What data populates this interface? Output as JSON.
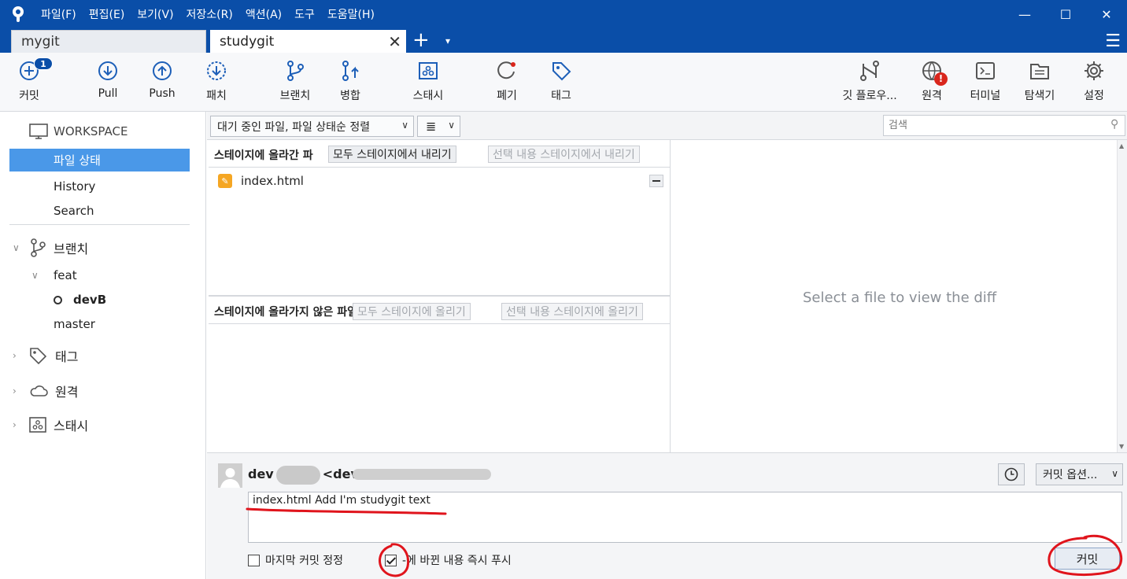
{
  "window": {
    "menu": [
      "파일(F)",
      "편집(E)",
      "보기(V)",
      "저장소(R)",
      "액션(A)",
      "도구",
      "도움말(H)"
    ],
    "controls": {
      "minimize": "—",
      "maximize": "☐",
      "close": "✕"
    }
  },
  "tabs": [
    {
      "label": "mygit",
      "active": false
    },
    {
      "label": "studygit",
      "active": true
    }
  ],
  "tab_actions": {
    "close": "✕",
    "add": "+",
    "dropdown": "▾",
    "menu": "☰"
  },
  "toolbar": {
    "commit": {
      "label": "커밋",
      "badge": "1"
    },
    "pull": "Pull",
    "push": "Push",
    "patch": "패치",
    "branch": "브랜치",
    "merge": "병합",
    "stash": "스태시",
    "discard": "폐기",
    "tag": "태그",
    "gitflow": "깃 플로우...",
    "remote": {
      "label": "원격",
      "alert": "!"
    },
    "terminal": "터미널",
    "explorer": "탐색기",
    "settings": "설정"
  },
  "sidebar": {
    "workspace": "WORKSPACE",
    "workspace_items": [
      "파일 상태",
      "History",
      "Search"
    ],
    "selected": "파일 상태",
    "branches_label": "브랜치",
    "branch_folder": "feat",
    "branches": [
      {
        "name": "devB",
        "current": true
      },
      {
        "name": "master",
        "current": false
      }
    ],
    "tags_label": "태그",
    "remotes_label": "원격",
    "stashes_label": "스태시"
  },
  "filter": {
    "sort": "대기 중인 파일, 파일 상태순 정렬",
    "view": "≣",
    "search_placeholder": "검색"
  },
  "staged": {
    "title": "스테이지에 올라간 파",
    "unstage_all": "모두 스테이지에서 내리기",
    "unstage_selected": "선택 내용 스테이지에서 내리기",
    "files": [
      {
        "name": "index.html",
        "status": "modified"
      }
    ]
  },
  "unstaged": {
    "title": "스테이지에 올라가지 않은 파일",
    "stage_all": "모두 스테이지에 올리기",
    "stage_selected": "선택 내용 스테이지에 올리기",
    "files": []
  },
  "diff": {
    "placeholder": "Select a file to view the diff"
  },
  "commit": {
    "author_name": "dev",
    "author_email_prefix": "<dev",
    "options": "커밋 옵션...",
    "message": "index.html Add I'm studygit text",
    "amend_label": "마지막 커밋 정정",
    "amend_checked": false,
    "push_label": "-에 바뀐 내용 즉시 푸시",
    "push_checked": true,
    "button": "커밋"
  },
  "colors": {
    "titlebar": "#0a4ea8",
    "selection": "#4a98e8",
    "annotation": "#e0141c"
  }
}
